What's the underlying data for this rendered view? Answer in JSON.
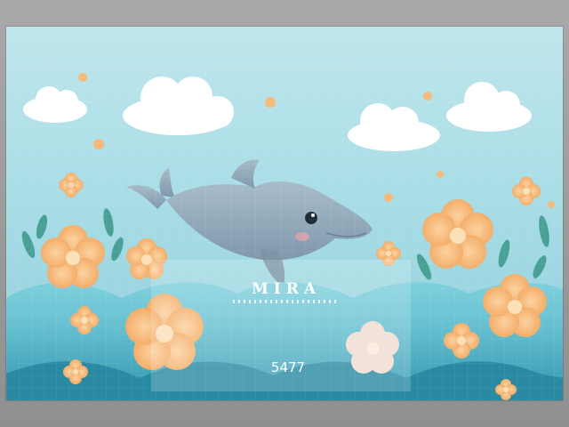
{
  "watermark": {
    "brand": "MIRA",
    "code": "5477"
  },
  "colors": {
    "sky": "#b3e1e8",
    "cloud": "#ffffff",
    "dolphin": "#8fa7b8",
    "flower": "#f5b97a",
    "flower_center": "#fbe0b8",
    "waves": "#4fb3c8",
    "leaves": "#3f9a8f"
  },
  "scene": {
    "subject": "dolphin-icon",
    "elements": [
      "cloud-icon",
      "flower-icon",
      "wave-icon",
      "leaf-icon"
    ]
  }
}
